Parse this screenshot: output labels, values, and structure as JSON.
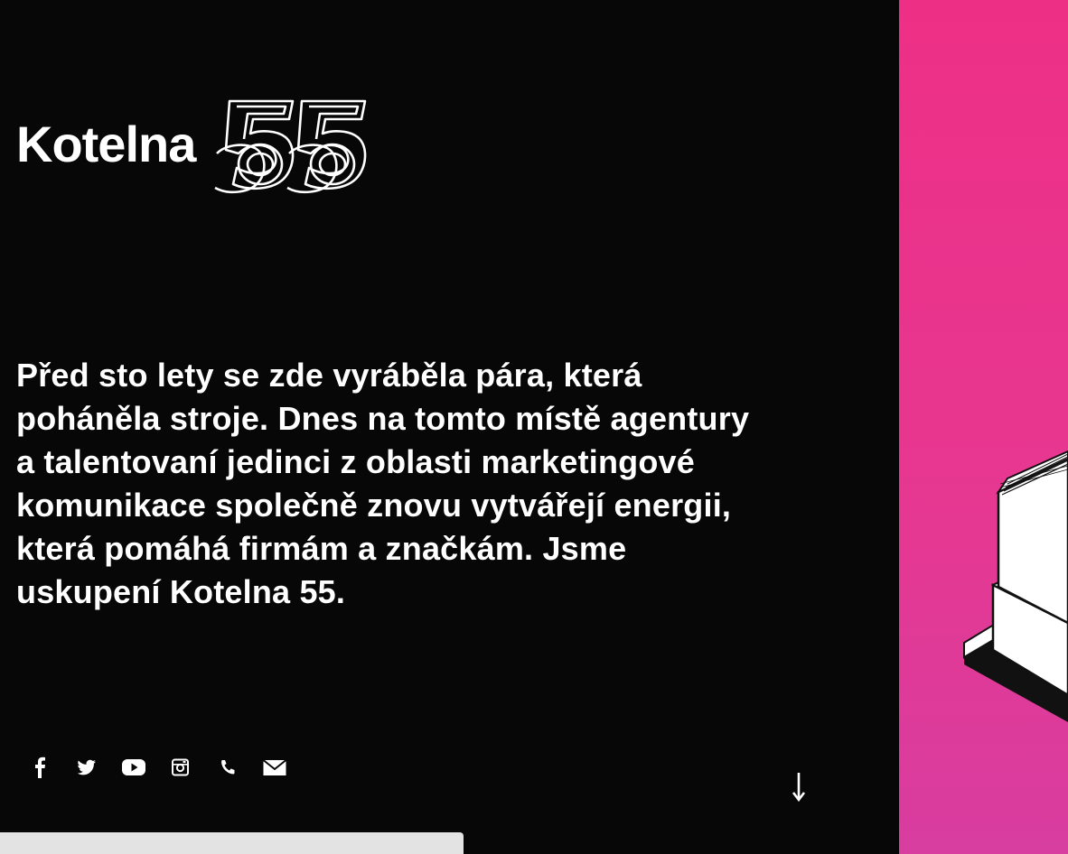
{
  "brand": {
    "name": "Kotelna",
    "number": "55"
  },
  "intro": {
    "text": "Před sto lety se zde vyráběla pára, která poháněla stroje. Dnes na tomto místě agentury a talentovaní jedinci z oblasti marketingové komunikace společně znovu vytvářejí energii, která pomáhá firmám a značkám. Jsme uskupení Kotelna 55."
  },
  "social": [
    {
      "icon": "facebook-icon"
    },
    {
      "icon": "twitter-icon"
    },
    {
      "icon": "youtube-icon"
    },
    {
      "icon": "instagram-icon"
    },
    {
      "icon": "phone-icon"
    },
    {
      "icon": "mail-icon"
    }
  ],
  "colors": {
    "background": "#070707",
    "accent_pink": "#ee2f86",
    "text": "#ffffff",
    "cookie_bar": "#e3e3e3"
  }
}
